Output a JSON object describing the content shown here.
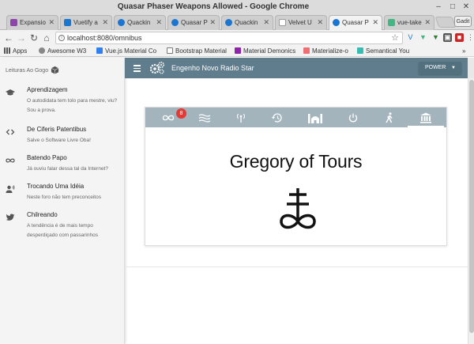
{
  "window": {
    "title": "Quasar Phaser Weapons Allowed - Google Chrome",
    "profile_label": "Gadit"
  },
  "tabs": [
    {
      "label": "Expansio",
      "favicon": "expansion-favicon",
      "color": "#8e44ad"
    },
    {
      "label": "Vuetify a",
      "favicon": "vuetify-favicon",
      "color": "#1976d2"
    },
    {
      "label": "Quackin",
      "favicon": "quasar-favicon",
      "color": "#1976d2"
    },
    {
      "label": "Quasar P",
      "favicon": "quasar-favicon",
      "color": "#1976d2"
    },
    {
      "label": "Quackin",
      "favicon": "quasar-favicon",
      "color": "#1976d2"
    },
    {
      "label": "Velvet U",
      "favicon": "page-favicon",
      "color": "#bbbbbb"
    },
    {
      "label": "Quasar P",
      "favicon": "quasar-favicon",
      "color": "#1976d2",
      "active": true
    },
    {
      "label": "vue-take",
      "favicon": "vue-favicon",
      "color": "#41b883"
    }
  ],
  "address": {
    "url": "localhost:8080/omnibus"
  },
  "bookmarks": [
    {
      "label": "Apps",
      "icon": "apps-grid-icon",
      "color": "#555555"
    },
    {
      "label": "Awesome W3",
      "icon": "globe-icon",
      "color": "#666666"
    },
    {
      "label": "Vue.js Material Co",
      "icon": "vue-icon",
      "color": "#2f80ed"
    },
    {
      "label": "Bootstrap Material",
      "icon": "page-icon",
      "color": "#ffffff"
    },
    {
      "label": "Material Demonics",
      "icon": "material-icon",
      "color": "#8e24aa"
    },
    {
      "label": "Materialize-o",
      "icon": "materialize-icon",
      "color": "#ee6e73"
    },
    {
      "label": "Semantical You",
      "icon": "semantic-icon",
      "color": "#35bdb2"
    }
  ],
  "sidebar": {
    "header": "Leituras Ao Gogo",
    "items": [
      {
        "title": "Aprendizagem",
        "subtitle": "O autodidata tem tolo para mestre, viu? Sou a prova.",
        "icon": "school-icon"
      },
      {
        "title": "De Ciferis Patentibus",
        "subtitle": "Salve o Software Livre Oba!",
        "icon": "code-icon"
      },
      {
        "title": "Batendo Papo",
        "subtitle": "Já ouviu falar dessa tal da Internet?",
        "icon": "infinity-icon"
      },
      {
        "title": "Trocando Uma Idéia",
        "subtitle": "Neste foro não tem preconceitos",
        "icon": "record-voice-icon"
      },
      {
        "title": "Chilreando",
        "subtitle": "A tendência é de mais tempo desperdiçado com passarinhos",
        "icon": "twitter-icon"
      }
    ]
  },
  "appbar": {
    "title": "Engenho Novo Radio Star",
    "power_label": "POWER"
  },
  "card": {
    "badge": "8",
    "title": "Gregory of Tours",
    "tabs": [
      "infinity-tab",
      "waves-tab",
      "antenna-tab",
      "history-tab",
      "mosque-tab",
      "power-tab",
      "walk-tab",
      "museum-tab"
    ],
    "active_tab": "museum-tab"
  },
  "colors": {
    "appbar": "#5f7d8c",
    "card_tabs": "#a3b4bd",
    "badge": "#e53935"
  }
}
